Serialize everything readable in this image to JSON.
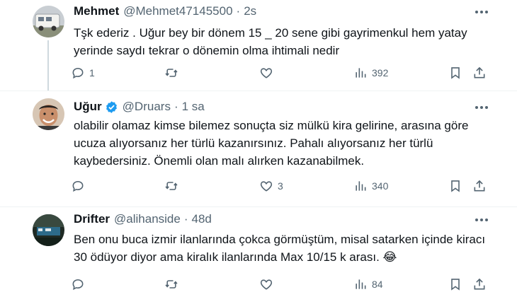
{
  "tweets": [
    {
      "name": "Mehmet",
      "handle": "@Mehmet47145500",
      "dot": "·",
      "time": "2s",
      "verified": false,
      "text": "Tşk ederiz . Uğur bey bir dönem 15 _ 20 sene gibi gayrimenkul hem yatay yerinde saydı tekrar o dönemin olma ihtimali nedir",
      "replies": "1",
      "retweets": "",
      "likes": "",
      "views": "392"
    },
    {
      "name": "Uğur",
      "handle": "@Druars",
      "dot": "·",
      "time": "1 sa",
      "verified": true,
      "text": "olabilir olamaz kimse bilemez sonuçta siz mülkü kira gelirine, arasına göre ucuza alıyorsanız her türlü kazanırsınız. Pahalı alıyorsanız her türlü kaybedersiniz. Önemli olan malı alırken kazanabilmek.",
      "replies": "",
      "retweets": "",
      "likes": "3",
      "views": "340"
    },
    {
      "name": "Drifter",
      "handle": "@alihanside",
      "dot": "·",
      "time": "48d",
      "verified": false,
      "text": "Ben onu buca izmir ilanlarında çokca görmüştüm,  misal satarken içinde kiracı 30 ödüyor diyor ama kiralık ilanlarında Max 10/15 k arası. 😂",
      "replies": "",
      "retweets": "",
      "likes": "",
      "views": "84"
    }
  ],
  "icons": {
    "reply": "reply-icon",
    "retweet": "retweet-icon",
    "like": "heart-icon",
    "views": "views-icon",
    "bookmark": "bookmark-icon",
    "share": "share-icon",
    "more": "more-icon",
    "verified": "verified-badge-icon"
  },
  "colors": {
    "text": "#0f1419",
    "secondary": "#536471",
    "verified": "#1d9bf0",
    "divider": "#eff3f4"
  }
}
